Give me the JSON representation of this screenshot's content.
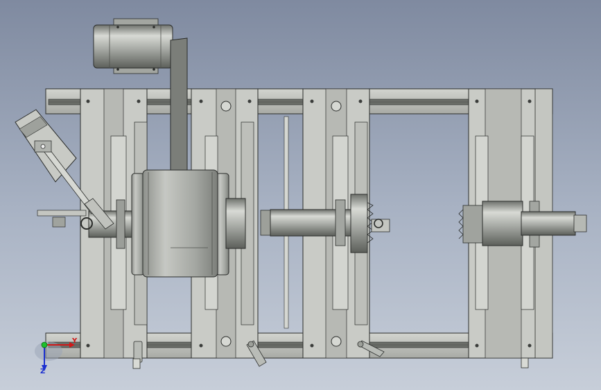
{
  "view": {
    "background_top": "#7f8aa0",
    "background_bottom": "#c7ced9"
  },
  "colors": {
    "rail": "#bfc1bc",
    "rail_dark": "#5f625c",
    "plate": "#c9cbc6",
    "plate_inner": "#b7b9b4",
    "steel": "#9da09a",
    "steel_dark": "#6d706b",
    "motor": "#c2c4bf",
    "belt": "#7b7e79",
    "outline": "#2a2c2a"
  },
  "axis_triad": {
    "y_label": "Y",
    "z_label": "Z",
    "y_color": "#d01818",
    "z_color": "#1b2fd0",
    "origin_color": "#1fbf2c"
  }
}
